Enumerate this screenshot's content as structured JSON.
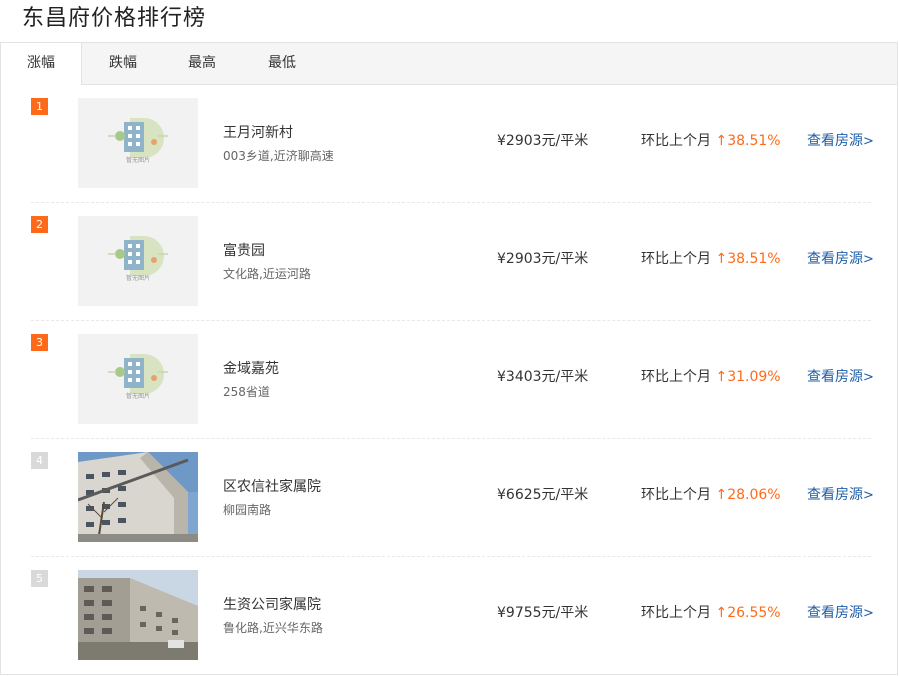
{
  "page": {
    "title": "东昌府价格排行榜"
  },
  "tabs": [
    {
      "label": "涨幅",
      "active": true
    },
    {
      "label": "跌幅",
      "active": false
    },
    {
      "label": "最高",
      "active": false
    },
    {
      "label": "最低",
      "active": false
    }
  ],
  "list": {
    "compare_label": "环比上个月",
    "link_label": "查看房源",
    "placeholder_caption": "暂无图片",
    "items": [
      {
        "rank": "1",
        "name": "王月河新村",
        "address": "003乡道,近济聊高速",
        "price": "¥2903元/平米",
        "change": "38.51%",
        "image": "placeholder-image"
      },
      {
        "rank": "2",
        "name": "富贵园",
        "address": "文化路,近运河路",
        "price": "¥2903元/平米",
        "change": "38.51%",
        "image": "placeholder-image"
      },
      {
        "rank": "3",
        "name": "金域嘉苑",
        "address": "258省道",
        "price": "¥3403元/平米",
        "change": "31.09%",
        "image": "placeholder-image"
      },
      {
        "rank": "4",
        "name": "区农信社家属院",
        "address": "柳园南路",
        "price": "¥6625元/平米",
        "change": "28.06%",
        "image": "building-photo"
      },
      {
        "rank": "5",
        "name": "生资公司家属院",
        "address": "鲁化路,近兴华东路",
        "price": "¥9755元/平米",
        "change": "26.55%",
        "image": "building-photo"
      }
    ]
  },
  "colors": {
    "accent": "#ff6a1a",
    "link": "#1f5ea8",
    "rank_inactive": "#d9d9d9"
  },
  "icons": {
    "up_arrow": "arrow-up-icon",
    "link_arrow": "chevron-right-icon"
  }
}
